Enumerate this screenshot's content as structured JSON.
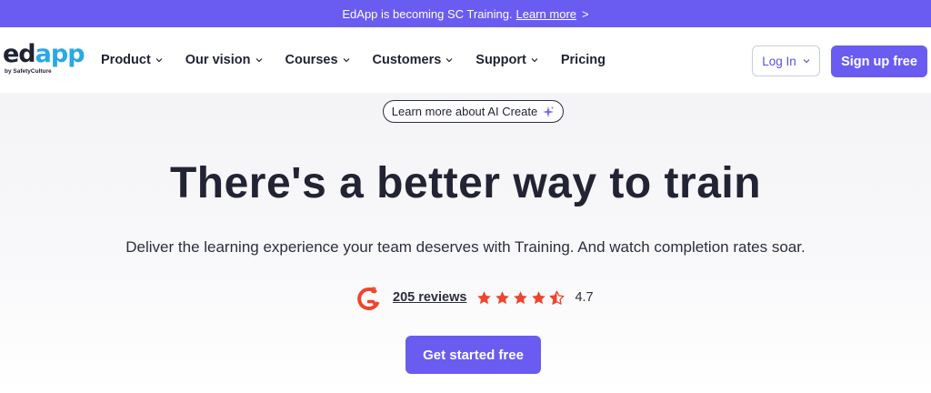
{
  "announcement": {
    "text": "EdApp is becoming SC Training.",
    "link": "Learn more",
    "arrow": ">"
  },
  "logo": {
    "ed": "ed",
    "app": "app",
    "tagline": "by SafetyCulture"
  },
  "nav": {
    "items": [
      {
        "label": "Product",
        "dropdown": true
      },
      {
        "label": "Our vision",
        "dropdown": true
      },
      {
        "label": "Courses",
        "dropdown": true
      },
      {
        "label": "Customers",
        "dropdown": true
      },
      {
        "label": "Support",
        "dropdown": true
      },
      {
        "label": "Pricing",
        "dropdown": false
      }
    ],
    "login_label": "Log In",
    "signup_label": "Sign up free"
  },
  "hero": {
    "pill_label": "Learn more about AI Create",
    "headline": "There's a better way to train",
    "subheadline": "Deliver the learning experience your team deserves with Training. And watch completion rates soar.",
    "reviews_label": "205 reviews",
    "rating": "4.7",
    "stars_full": 4,
    "stars_half": 1,
    "cta_label": "Get started free"
  },
  "colors": {
    "brand_purple": "#6a5cf0",
    "logo_blue": "#2aa8e6",
    "star_red": "#f0442c",
    "g2_red": "#f0442c"
  },
  "icons": [
    "chevron-down-icon",
    "sparkle-icon",
    "g2-logo-icon",
    "star-icon",
    "half-star-icon"
  ]
}
